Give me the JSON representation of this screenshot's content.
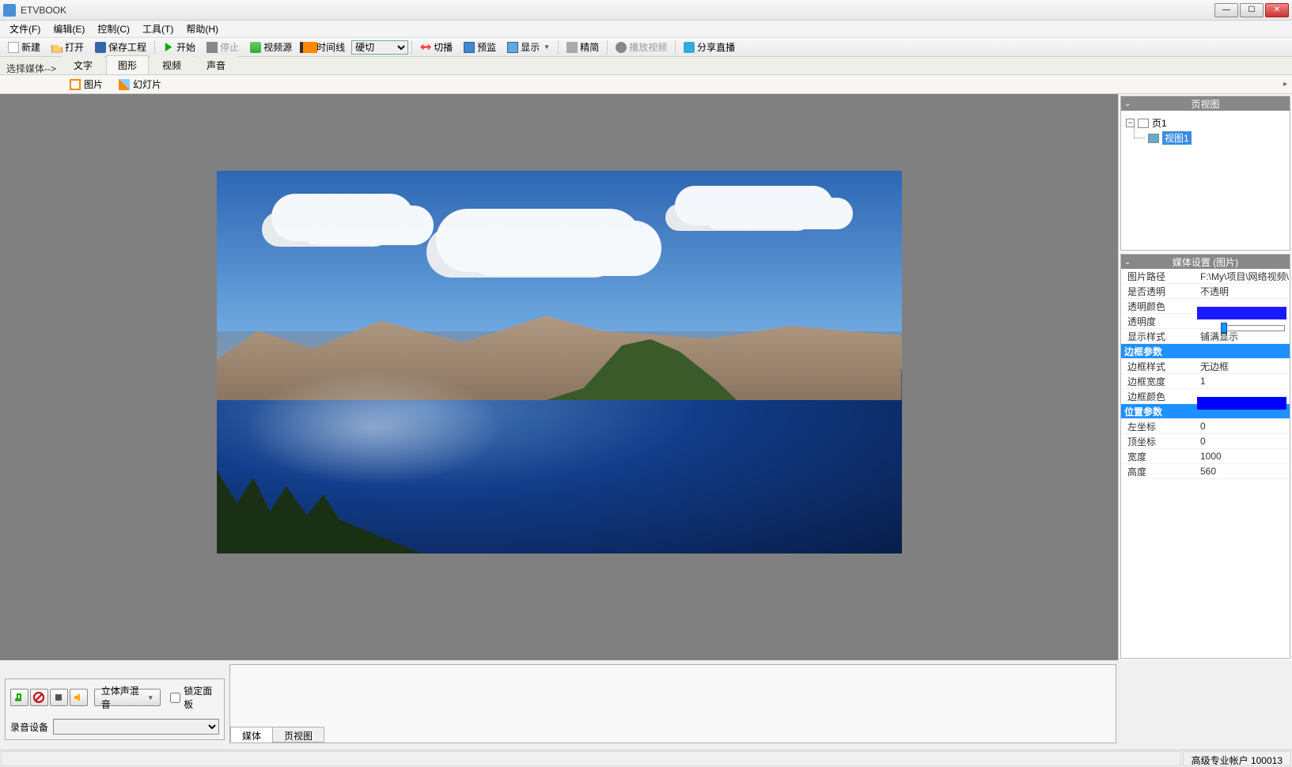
{
  "app": {
    "title": "ETVBOOK"
  },
  "menubar": {
    "file": "文件(F)",
    "edit": "编辑(E)",
    "control": "控制(C)",
    "tools": "工具(T)",
    "help": "帮助(H)"
  },
  "toolbar": {
    "new": "新建",
    "open": "打开",
    "save": "保存工程",
    "start": "开始",
    "stop": "停止",
    "videosource": "视频源",
    "timeline": "时间线",
    "transition_select": "硬切",
    "switch": "切播",
    "monitor": "预监",
    "display": "显示",
    "simple": "精简",
    "playback": "播放视频",
    "share": "分享直播"
  },
  "ribbon": {
    "select_media_label": "选择媒体-->",
    "tabs": {
      "text": "文字",
      "shape": "图形",
      "video": "视频",
      "sound": "声音"
    },
    "buttons": {
      "image": "图片",
      "slides": "幻灯片"
    }
  },
  "tree_panel": {
    "title": "页视图",
    "root": "页1",
    "child": "视图1"
  },
  "props_panel": {
    "title": "媒体设置 (图片)",
    "image_path_label": "图片路径",
    "image_path_value": "F:\\My\\项目\\网络视频\\",
    "transparent_label": "是否透明",
    "transparent_value": "不透明",
    "trans_color_label": "透明颜色",
    "trans_color_value": "#1a1aff",
    "opacity_label": "透明度",
    "display_style_label": "显示样式",
    "display_style_value": "铺满显示",
    "border_section": "边框参数",
    "border_style_label": "边框样式",
    "border_style_value": "无边框",
    "border_width_label": "边框宽度",
    "border_width_value": "1",
    "border_color_label": "边框颜色",
    "border_color_value": "#0000ff",
    "position_section": "位置参数",
    "left_label": "左坐标",
    "left_value": "0",
    "top_label": "顶坐标",
    "top_value": "0",
    "width_label": "宽度",
    "width_value": "1000",
    "height_label": "高度",
    "height_value": "560"
  },
  "audio": {
    "stereo_mix": "立体声混音",
    "lock_panel": "锁定面板",
    "rec_device_label": "录音设备"
  },
  "bottom_tabs": {
    "media": "媒体",
    "pageview": "页视图"
  },
  "status": {
    "account": "高级专业帐户 100013"
  }
}
